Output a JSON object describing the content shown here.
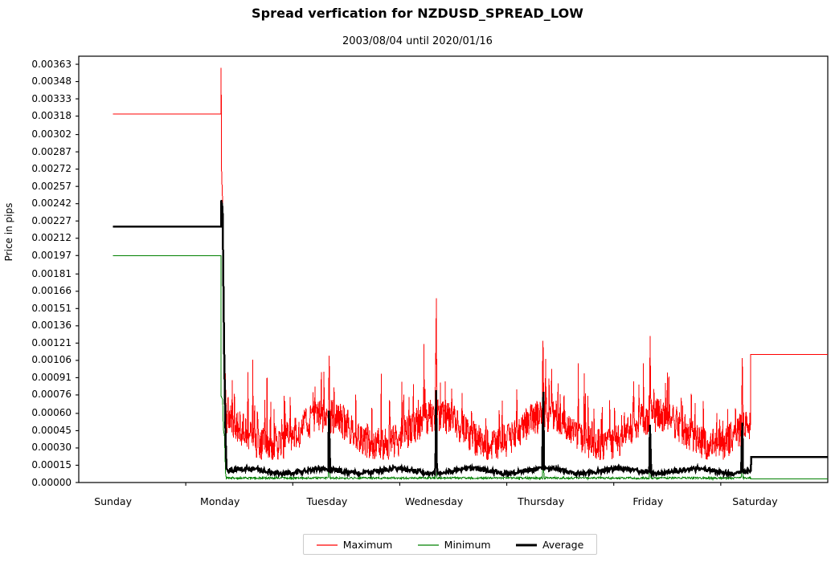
{
  "chart_data": {
    "type": "line",
    "title": "Spread verfication for NZDUSD_SPREAD_LOW",
    "subtitle": "2003/08/04 until 2020/01/16",
    "xlabel": "",
    "ylabel": "Price in pips",
    "ylim": [
      0.0,
      0.0037
    ],
    "xlim": [
      0,
      7
    ],
    "grid": false,
    "legend_position": "bottom-center",
    "categories": [
      "Sunday",
      "Monday",
      "Tuesday",
      "Wednesday",
      "Thursday",
      "Friday",
      "Saturday"
    ],
    "ytick_labels": [
      "0.00363",
      "0.00348",
      "0.00333",
      "0.00318",
      "0.00302",
      "0.00287",
      "0.00272",
      "0.00257",
      "0.00242",
      "0.00227",
      "0.00212",
      "0.00197",
      "0.00181",
      "0.00166",
      "0.00151",
      "0.00136",
      "0.00121",
      "0.00106",
      "0.00091",
      "0.00076",
      "0.00060",
      "0.00045",
      "0.00030",
      "0.00015",
      "0.00000"
    ],
    "ytick_values": [
      0.00363,
      0.00348,
      0.00333,
      0.00318,
      0.00302,
      0.00287,
      0.00272,
      0.00257,
      0.00242,
      0.00227,
      0.00212,
      0.00197,
      0.00181,
      0.00166,
      0.00151,
      0.00136,
      0.00121,
      0.00106,
      0.00091,
      0.00076,
      0.0006,
      0.00045,
      0.0003,
      0.00015,
      0.0
    ],
    "series": [
      {
        "name": "Maximum",
        "color": "#ff0000",
        "linewidth": 1.0,
        "description": "Weekend plateau at 0.00320, spike to 0.00360 at market open Sunday night, decaying to intraday noise band 0.00030-0.00060 with spikes up to 0.00110-0.00165 at daily rollovers; Friday close plateau at 0.00111",
        "weekend_start_level": 0.0032,
        "open_spike_peak": 0.0036,
        "weekend_end_level": 0.00111,
        "noise_band": [
          0.00028,
          0.00062
        ],
        "rollover_peaks": [
          0.00165,
          0.0011,
          0.0016,
          0.00123,
          0.00127,
          0.00108
        ]
      },
      {
        "name": "Minimum",
        "color": "#008000",
        "linewidth": 1.0,
        "description": "Weekend plateau at 0.00197, drops to near 0.00003 during trading week with small rollover bumps to ~0.00070; returns to ~0.00003 plateau after Friday close",
        "weekend_start_level": 0.00197,
        "weekend_end_level": 3e-05,
        "trading_level": 3e-05,
        "rollover_peaks": [
          0.0007,
          0.00045,
          0.0006,
          0.0005,
          0.0005,
          0.00045
        ]
      },
      {
        "name": "Average",
        "color": "#000000",
        "linewidth": 2.5,
        "description": "Weekend plateau at 0.00222, spike to 0.00245 at Sunday open, falls to trading level ~0.00008; daily rollover spikes to 0.00075-0.00121; after Friday close plateau at 0.00022",
        "weekend_start_level": 0.00222,
        "open_spike_peak": 0.00245,
        "weekend_end_level": 0.00022,
        "trading_level": 8e-05,
        "rollover_peaks": [
          0.00093,
          0.0008,
          0.00121,
          0.00072,
          0.00075
        ]
      }
    ]
  },
  "legend": {
    "items": [
      {
        "label": "Maximum",
        "color": "#ff0000",
        "width": 1.2
      },
      {
        "label": "Minimum",
        "color": "#008000",
        "width": 1.2
      },
      {
        "label": "Average",
        "color": "#000000",
        "width": 3.0
      }
    ]
  }
}
